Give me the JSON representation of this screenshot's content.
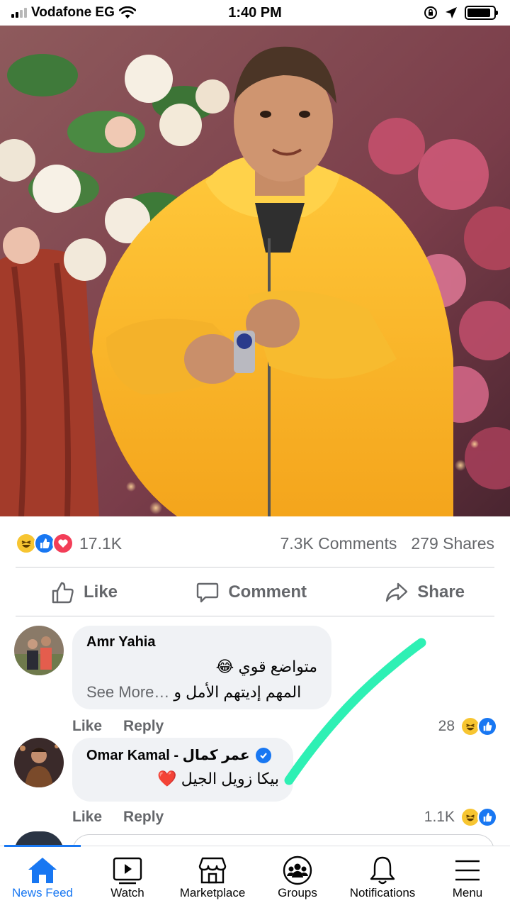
{
  "status_bar": {
    "carrier": "Vodafone EG",
    "time": "1:40 PM",
    "battery_level": 0.9
  },
  "post": {
    "reactions": {
      "types": [
        "haha",
        "like",
        "love"
      ],
      "count": "17.1K"
    },
    "comments_count": "7.3K Comments",
    "shares_count": "279 Shares",
    "actions": {
      "like": "Like",
      "comment": "Comment",
      "share": "Share"
    }
  },
  "comments": [
    {
      "author": "Amr Yahia",
      "verified": false,
      "line1": "متواضع قوي 😂",
      "line2": "المهم إديتهم الأمل و",
      "see_more": "See More…",
      "like_label": "Like",
      "reply_label": "Reply",
      "reaction_count": "28",
      "reaction_types": [
        "haha",
        "like"
      ]
    },
    {
      "author": "Omar Kamal - عمر كمال",
      "verified": true,
      "line1": "بيكا زويل الجيل ❤️",
      "like_label": "Like",
      "reply_label": "Reply",
      "reaction_count": "1.1K",
      "reaction_types": [
        "haha",
        "like"
      ]
    }
  ],
  "tabbar": [
    {
      "label": "News Feed",
      "icon": "home-icon",
      "active": true
    },
    {
      "label": "Watch",
      "icon": "watch-icon",
      "active": false
    },
    {
      "label": "Marketplace",
      "icon": "marketplace-icon",
      "active": false
    },
    {
      "label": "Groups",
      "icon": "groups-icon",
      "active": false
    },
    {
      "label": "Notifications",
      "icon": "bell-icon",
      "active": false
    },
    {
      "label": "Menu",
      "icon": "menu-icon",
      "active": false
    }
  ],
  "colors": {
    "accent": "#1877f2",
    "annotation_stroke": "#2ef0b4",
    "secondary_text": "#65676b"
  }
}
